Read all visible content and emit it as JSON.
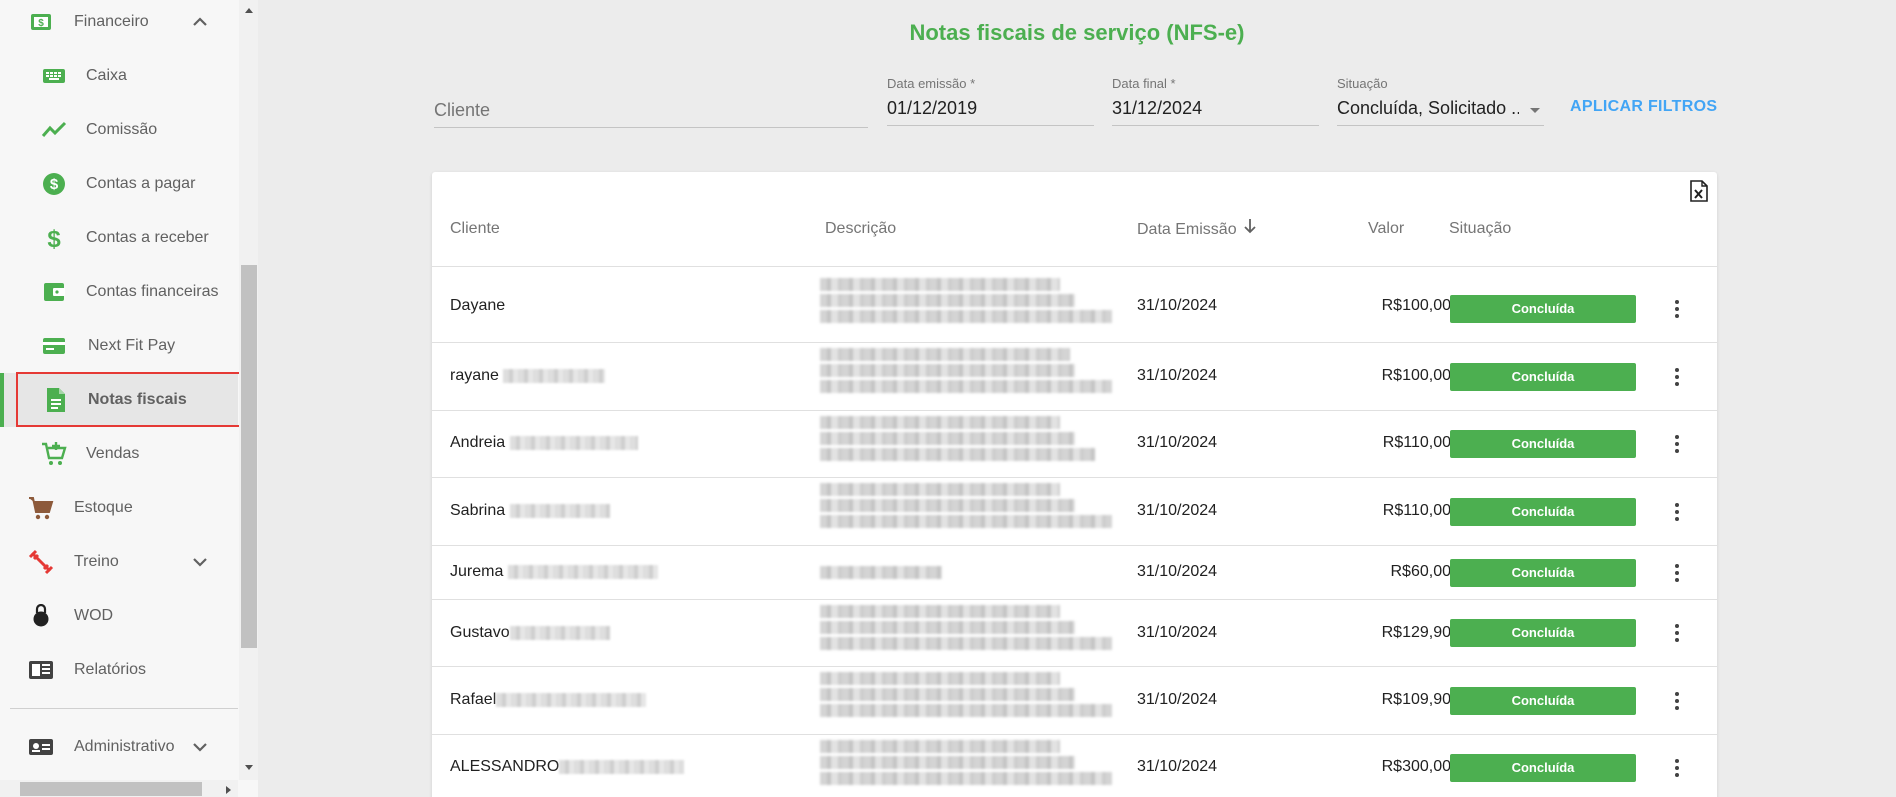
{
  "page": {
    "title": "Notas fiscais de serviço (NFS-e)"
  },
  "sidebar": {
    "items": [
      {
        "label": "Financeiro",
        "icon": "money-icon",
        "expanded": true
      },
      {
        "label": "Caixa",
        "icon": "keyboard-icon"
      },
      {
        "label": "Comissão",
        "icon": "trending-icon"
      },
      {
        "label": "Contas a pagar",
        "icon": "dollar-circle-icon"
      },
      {
        "label": "Contas a receber",
        "icon": "dollar-icon"
      },
      {
        "label": "Contas financeiras",
        "icon": "wallet-icon"
      },
      {
        "label": "Next Fit Pay",
        "icon": "card-icon"
      },
      {
        "label": "Notas fiscais",
        "icon": "document-icon",
        "active": true
      },
      {
        "label": "Vendas",
        "icon": "cart-add-icon"
      },
      {
        "label": "Estoque",
        "icon": "cart-icon"
      },
      {
        "label": "Treino",
        "icon": "dumbbell-icon",
        "expandable": true
      },
      {
        "label": "WOD",
        "icon": "kettlebell-icon"
      },
      {
        "label": "Relatórios",
        "icon": "report-icon"
      },
      {
        "label": "Administrativo",
        "icon": "id-card-icon",
        "expandable": true
      }
    ]
  },
  "filters": {
    "cliente_placeholder": "Cliente",
    "data_emissao_label": "Data emissão *",
    "data_emissao_value": "01/12/2019",
    "data_final_label": "Data final *",
    "data_final_value": "31/12/2024",
    "situacao_label": "Situação",
    "situacao_value": "Concluída, Solicitado ...",
    "apply_label": "APLICAR FILTROS"
  },
  "table": {
    "headers": {
      "cliente": "Cliente",
      "descricao": "Descrição",
      "data_emissao": "Data Emissão",
      "valor": "Valor",
      "situacao": "Situação"
    },
    "rows": [
      {
        "cliente": "Dayane",
        "data": "31/10/2024",
        "valor": "R$100,00",
        "situacao": "Concluída"
      },
      {
        "cliente": "rayane",
        "data": "31/10/2024",
        "valor": "R$100,00",
        "situacao": "Concluída"
      },
      {
        "cliente": "Andreia",
        "data": "31/10/2024",
        "valor": "R$110,00",
        "situacao": "Concluída"
      },
      {
        "cliente": "Sabrina",
        "data": "31/10/2024",
        "valor": "R$110,00",
        "situacao": "Concluída"
      },
      {
        "cliente": "Jurema",
        "data": "31/10/2024",
        "valor": "R$60,00",
        "situacao": "Concluída"
      },
      {
        "cliente": "Gustavo",
        "data": "31/10/2024",
        "valor": "R$129,90",
        "situacao": "Concluída"
      },
      {
        "cliente": "Rafael",
        "data": "31/10/2024",
        "valor": "R$109,90",
        "situacao": "Concluída"
      },
      {
        "cliente": "ALESSANDRO",
        "data": "31/10/2024",
        "valor": "R$300,00",
        "situacao": "Concluída"
      }
    ]
  },
  "colors": {
    "accent": "#4caf50",
    "link": "#42a5f5",
    "highlight": "#e53935"
  }
}
